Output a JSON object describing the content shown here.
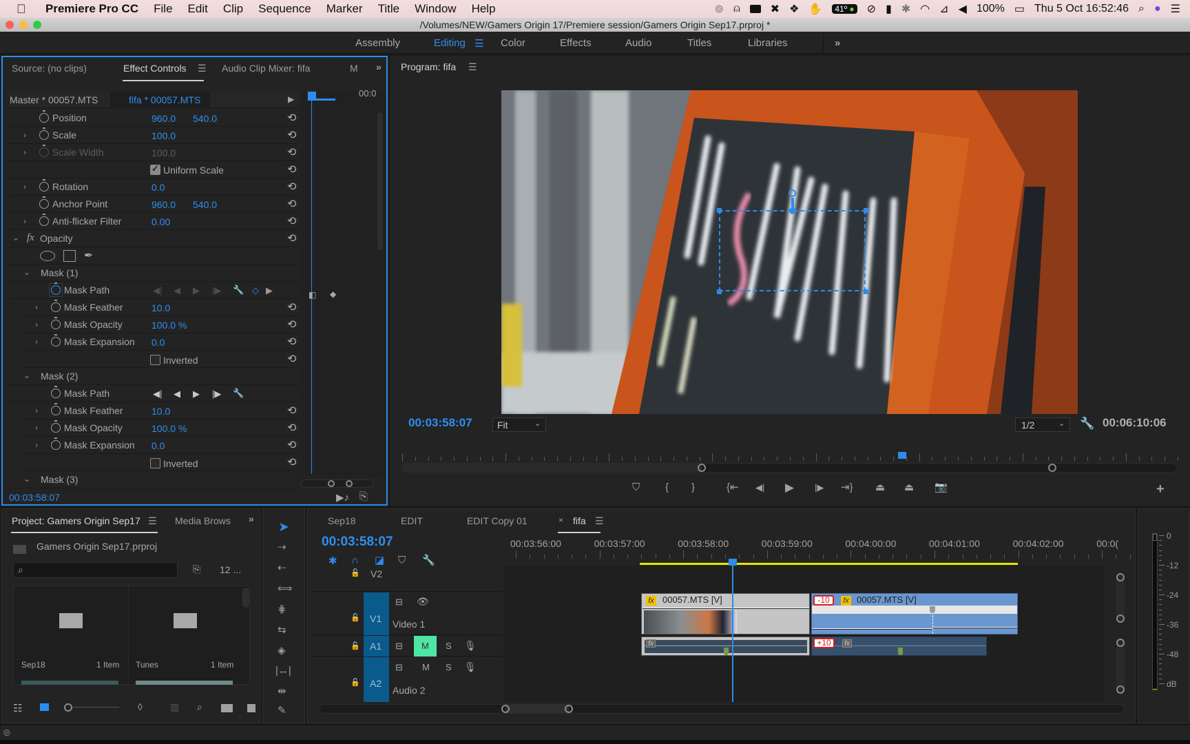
{
  "menubar": {
    "app_name": "Premiere Pro CC",
    "items": [
      "File",
      "Edit",
      "Clip",
      "Sequence",
      "Marker",
      "Title",
      "Window",
      "Help"
    ],
    "status": {
      "temperature": "41º",
      "battery": "100%",
      "datetime": "Thu 5 Oct  16:52:46"
    }
  },
  "window": {
    "title": "/Volumes/NEW/Gamers Origin 17/Premiere session/Gamers Origin Sep17.prproj *"
  },
  "workspaces": {
    "items": [
      "Assembly",
      "Editing",
      "Color",
      "Effects",
      "Audio",
      "Titles",
      "Libraries"
    ],
    "active": "Editing",
    "overflow": "»"
  },
  "effect_controls": {
    "tabs": [
      "Source: (no clips)",
      "Effect Controls",
      "Audio Clip Mixer: fifa",
      "M"
    ],
    "active_tab": "Effect Controls",
    "master_clip": "Master * 00057.MTS",
    "sequence_clip": "fifa * 00057.MTS",
    "mini_timecode": "00:0",
    "current_time": "00:03:58:07",
    "motion_rows": [
      {
        "label": "Position",
        "v1": "960.0",
        "v2": "540.0",
        "expandable": false,
        "disabled": false
      },
      {
        "label": "Scale",
        "v1": "100.0",
        "v2": "",
        "expandable": true,
        "disabled": false
      },
      {
        "label": "Scale Width",
        "v1": "100.0",
        "v2": "",
        "expandable": true,
        "disabled": true
      },
      {
        "label": "Rotation",
        "v1": "0.0",
        "v2": "",
        "expandable": true,
        "disabled": false
      },
      {
        "label": "Anchor Point",
        "v1": "960.0",
        "v2": "540.0",
        "expandable": false,
        "disabled": false
      },
      {
        "label": "Anti-flicker Filter",
        "v1": "0.00",
        "v2": "",
        "expandable": true,
        "disabled": false
      }
    ],
    "uniform_scale": {
      "label": "Uniform Scale",
      "checked": true
    },
    "opacity": {
      "label": "Opacity",
      "fx": "fx"
    },
    "masks": [
      {
        "name": "Mask (1)",
        "path_label": "Mask Path",
        "feather_label": "Mask Feather",
        "feather": "10.0",
        "opacity_label": "Mask Opacity",
        "opacity": "100.0 %",
        "expansion_label": "Mask Expansion",
        "expansion": "0.0",
        "inverted_label": "Inverted",
        "inverted": false,
        "keyframed": true
      },
      {
        "name": "Mask (2)",
        "path_label": "Mask Path",
        "feather_label": "Mask Feather",
        "feather": "10.0",
        "opacity_label": "Mask Opacity",
        "opacity": "100.0 %",
        "expansion_label": "Mask Expansion",
        "expansion": "0.0",
        "inverted_label": "Inverted",
        "inverted": false,
        "keyframed": false
      },
      {
        "name": "Mask (3)"
      }
    ]
  },
  "program_monitor": {
    "title": "Program: fifa",
    "current_time": "00:03:58:07",
    "fit": "Fit",
    "resolution": "1/2",
    "duration": "00:06:10:06",
    "playhead_fraction": 0.645
  },
  "project": {
    "tabs": [
      "Project: Gamers Origin Sep17",
      "Media Brows"
    ],
    "active_tab": "Project: Gamers Origin Sep17",
    "file": "Gamers Origin Sep17.prproj",
    "search_placeholder": "",
    "item_count": "12 ...",
    "bins": [
      {
        "name": "Sep18",
        "count": "1 Item"
      },
      {
        "name": "Tunes",
        "count": "1 Item"
      }
    ]
  },
  "timeline": {
    "tabs": [
      "Sep18",
      "EDIT",
      "EDIT Copy 01",
      "fifa"
    ],
    "active_tab": "fifa",
    "current_time": "00:03:58:07",
    "ruler": [
      "00:03:56:00",
      "00:03:57:00",
      "00:03:58:00",
      "00:03:59:00",
      "00:04:00:00",
      "00:04:01:00",
      "00:04:02:00",
      "00:0("
    ],
    "tracks": [
      {
        "id": "V2",
        "name": ""
      },
      {
        "id": "V1",
        "name": "Video 1"
      },
      {
        "id": "A1",
        "name": ""
      },
      {
        "id": "A2",
        "name": "Audio 2"
      }
    ],
    "a1_mute_active": true,
    "mute_label": "M",
    "solo_label": "S",
    "clips": [
      {
        "track": "V1",
        "name": "00057.MTS [V]",
        "fx": "fx"
      },
      {
        "track": "V1",
        "name": "00057.MTS [V]",
        "fx": "fx",
        "offset": "-10"
      },
      {
        "track": "A1",
        "fx": "fx"
      },
      {
        "track": "A1",
        "fx": "fx",
        "offset": "+10"
      }
    ]
  },
  "audio_meter": {
    "labels": [
      "0",
      "-12",
      "-24",
      "-36",
      "-48",
      "dB"
    ]
  },
  "colors": {
    "accent": "#2d8ceb",
    "panel_bg": "#232323",
    "work_area": "#e6e600",
    "track_header_blue": "#0b5a8c",
    "mute_green": "#4ee6a3",
    "clip_selected": "#6a97cf",
    "offset_badge": "#d42020"
  }
}
